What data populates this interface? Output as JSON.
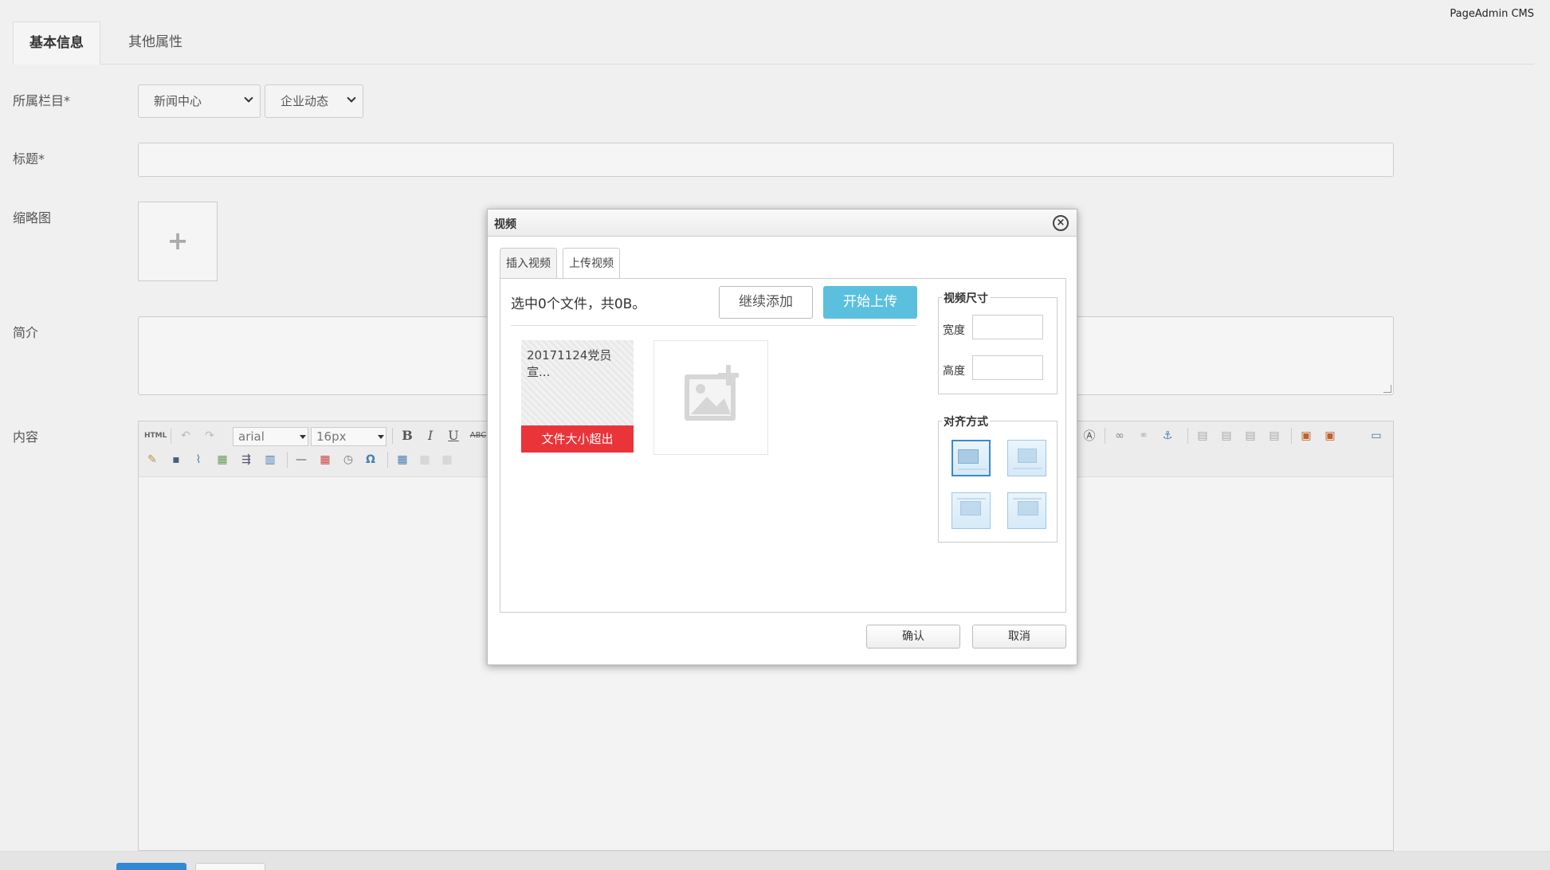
{
  "brand": "PageAdmin CMS",
  "tabs": [
    {
      "label": "基本信息",
      "active": true
    },
    {
      "label": "其他属性",
      "active": false
    }
  ],
  "form": {
    "column_label": "所属栏目*",
    "column_select_1": "新闻中心",
    "column_select_2": "企业动态",
    "title_label": "标题*",
    "title_value": "",
    "thumbnail_label": "缩略图",
    "thumbnail_add": "+",
    "summary_label": "简介",
    "summary_value": "",
    "content_label": "内容"
  },
  "editor": {
    "html_label": "HTML",
    "font_family": "arial",
    "font_size": "16px",
    "bold": "B",
    "italic": "I",
    "underline": "U",
    "strike": "ABC",
    "omega": "Ω"
  },
  "dialog": {
    "title": "视频",
    "close": "×",
    "tabs": [
      {
        "label": "插入视频",
        "active": false
      },
      {
        "label": "上传视频",
        "active": true
      }
    ],
    "upload_status": "选中0个文件，共0B。",
    "continue_button": "继续添加",
    "start_button": "开始上传",
    "file_name": "20171124党员宣...",
    "file_error": "文件大小超出",
    "size_legend": "视频尺寸",
    "width_label": "宽度",
    "width_value": "",
    "height_label": "高度",
    "height_value": "",
    "align_legend": "对齐方式",
    "confirm_button": "确认",
    "cancel_button": "取消"
  },
  "colors": {
    "start_button": "#5bc0de",
    "error": "#e93539",
    "primary": "#2f89d4"
  }
}
